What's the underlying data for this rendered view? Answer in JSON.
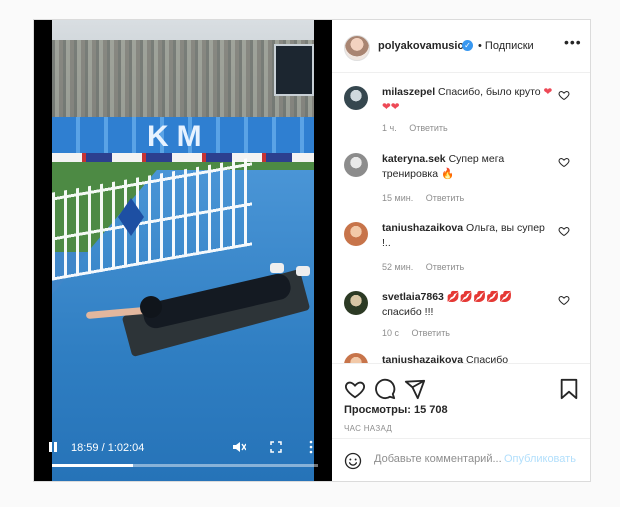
{
  "post": {
    "username": "polyakovamusic",
    "follow_label": "• Подписки",
    "more_label": "•••"
  },
  "video": {
    "current_time": "18:59",
    "duration": "1:02:04",
    "time_separator": " / ",
    "progress_fraction": 0.306,
    "stadium_letters": "KM"
  },
  "comments": [
    {
      "user": "milaszepel",
      "text": "Спасибо, было круто",
      "emoji": "❤❤❤",
      "age": "1 ч.",
      "reply": "Ответить",
      "likes": ""
    },
    {
      "user": "kateryna.sek",
      "text": "Супер мега тренировка",
      "emoji": "🔥",
      "age": "15 мин.",
      "reply": "Ответить",
      "likes": ""
    },
    {
      "user": "taniushazaikova",
      "text": "Ольга, вы супер !..",
      "emoji": "",
      "age": "52 мин.",
      "reply": "Ответить",
      "likes": ""
    },
    {
      "user": "svetlaia7863",
      "text": "спасибо !!!",
      "emoji": "💋💋💋💋💋",
      "age": "10 с",
      "reply": "Ответить",
      "likes": ""
    },
    {
      "user": "taniushazaikova",
      "text": "Спасибо",
      "emoji": "",
      "age": "",
      "reply": "",
      "likes": ""
    }
  ],
  "stats": {
    "views": "Просмотры: 15 708",
    "posted_ago": "ЧАС НАЗАД"
  },
  "add_comment": {
    "placeholder": "Добавьте комментарий...",
    "publish_label": "Опубликовать"
  },
  "colors": {
    "link_blue": "#3897f0",
    "publish_disabled": "#b2dffc",
    "heart_red": "#ed4956"
  }
}
